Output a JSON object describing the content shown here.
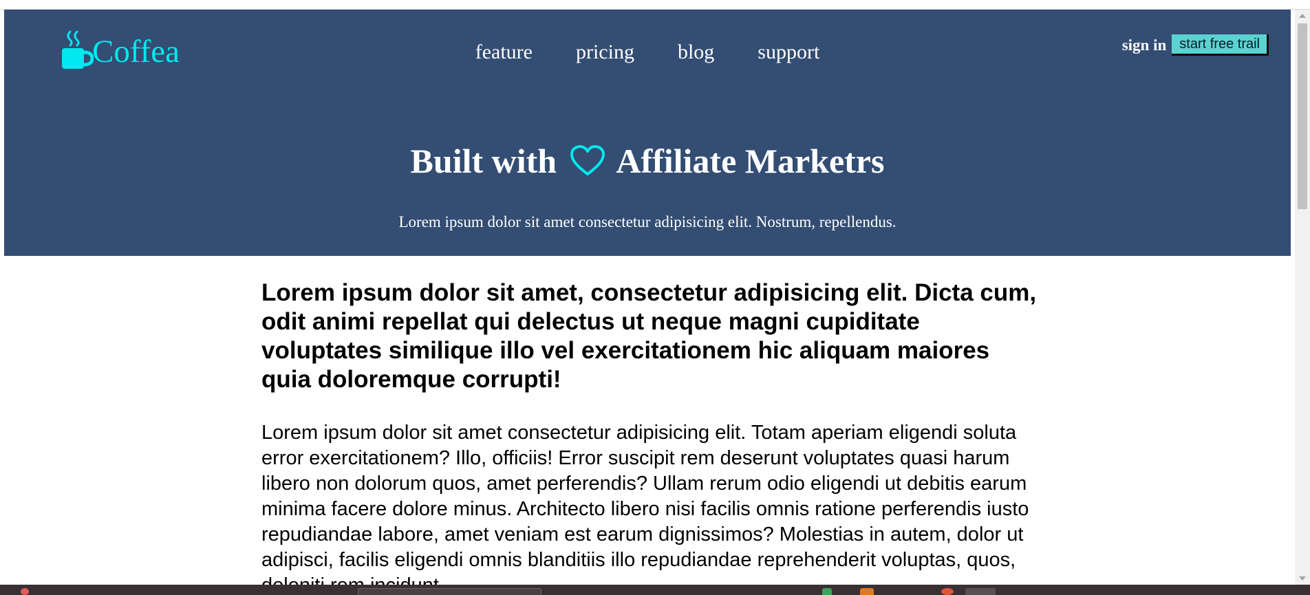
{
  "brand": {
    "name": "Coffea",
    "icon": "coffee-cup-icon",
    "color": "#00e9f0"
  },
  "nav": {
    "items": [
      "feature",
      "pricing",
      "blog",
      "support"
    ]
  },
  "auth": {
    "signin_label": "sign in",
    "trial_label": "start free trail"
  },
  "hero": {
    "title_before": "Built with",
    "title_icon": "heart-icon",
    "title_after": "Affiliate Marketrs",
    "subtitle": "Lorem ipsum dolor sit amet consectetur adipisicing elit. Nostrum, repellendus."
  },
  "content": {
    "heading": "Lorem ipsum dolor sit amet, consectetur adipisicing elit. Dicta cum, odit animi repellat qui delectus ut neque magni cupiditate voluptates similique illo vel exercitationem hic aliquam maiores quia doloremque corrupti!",
    "paragraph": "Lorem ipsum dolor sit amet consectetur adipisicing elit. Totam aperiam eligendi soluta error exercitationem? Illo, officiis! Error suscipit rem deserunt voluptates quasi harum libero non dolorum quos, amet perferendis? Ullam rerum odio eligendi ut debitis earum minima facere dolore minus. Architecto libero nisi facilis omnis ratione perferendis iusto repudiandae labore, amet veniam est earum dignissimos? Molestias in autem, dolor ut adipisci, facilis eligendi omnis blanditiis illo repudiandae reprehenderit voluptas, quos, deleniti rem incidunt"
  },
  "colors": {
    "header_bg": "#334d73",
    "accent": "#00e9f0",
    "button_bg": "#5bd3d0"
  }
}
